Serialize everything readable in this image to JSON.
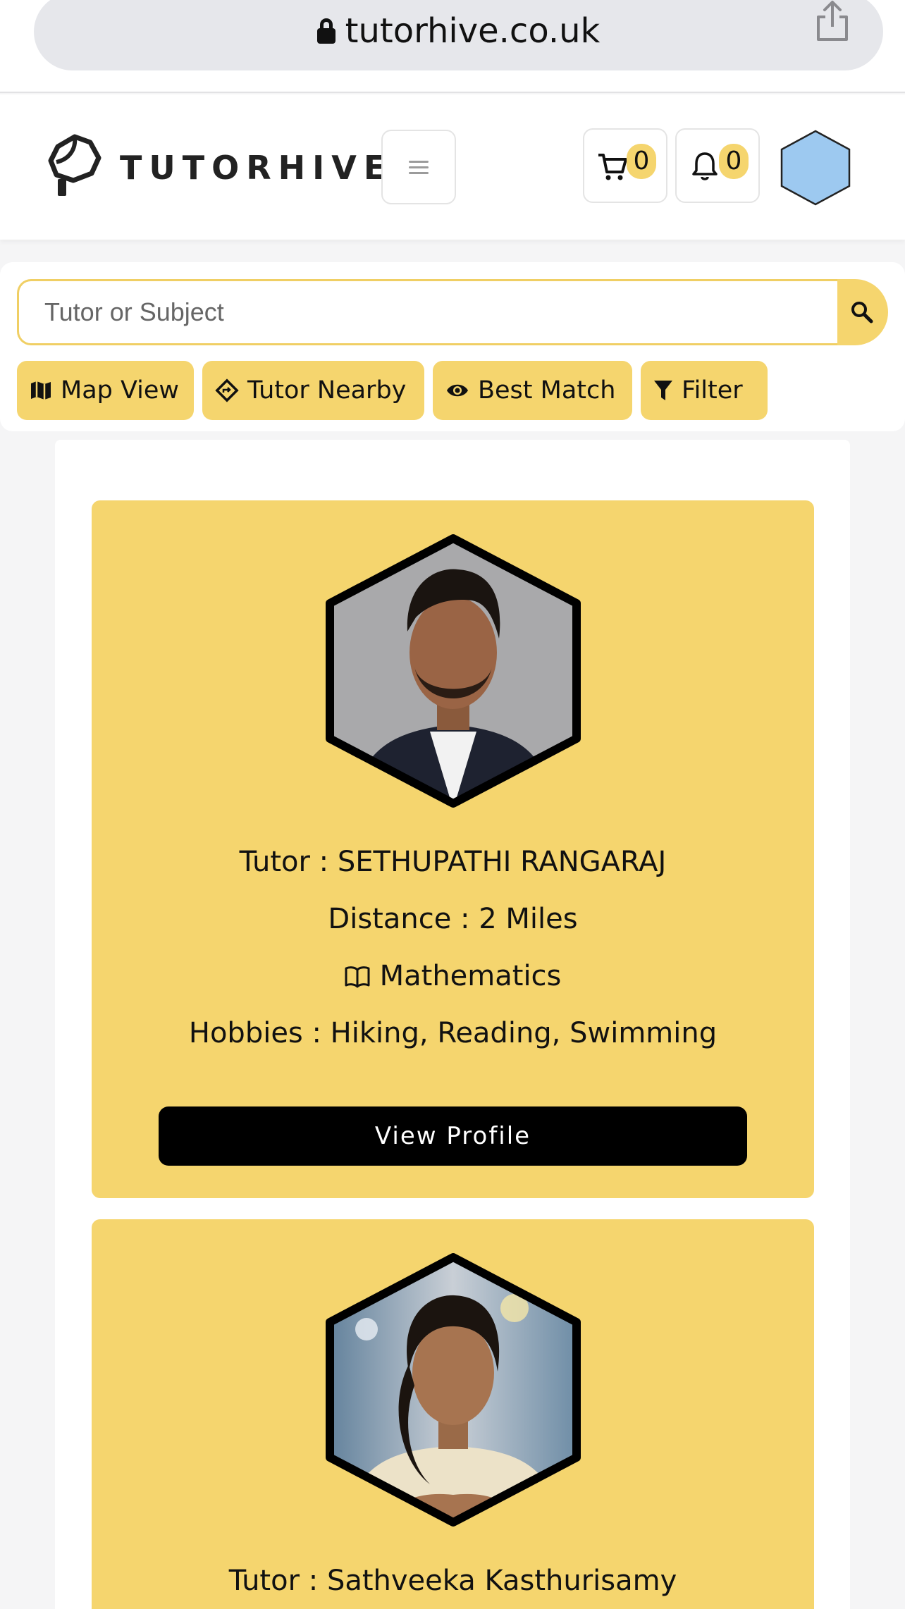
{
  "browser": {
    "url": "tutorhive.co.uk"
  },
  "header": {
    "brand": "TUTORHIVE",
    "cart_count": "0",
    "notification_count": "0",
    "avatar_color": "#9dc9f0"
  },
  "search": {
    "placeholder": "Tutor or Subject"
  },
  "filters": [
    {
      "label": "Map View",
      "icon": "map-icon"
    },
    {
      "label": "Tutor Nearby",
      "icon": "diamond-direction-icon"
    },
    {
      "label": "Best Match",
      "icon": "eye-icon"
    },
    {
      "label": "Filter",
      "icon": "funnel-icon"
    }
  ],
  "colors": {
    "accent": "#f5d56e",
    "button_dark": "#000000"
  },
  "tutors": [
    {
      "name_line": "Tutor : SETHUPATHI RANGARAJ",
      "distance_line": "Distance : 2 Miles",
      "subject": "Mathematics",
      "hobbies_line": "Hobbies : Hiking, Reading, Swimming",
      "button_label": "View Profile"
    },
    {
      "name_line": "Tutor : Sathveeka Kasthurisamy"
    }
  ]
}
